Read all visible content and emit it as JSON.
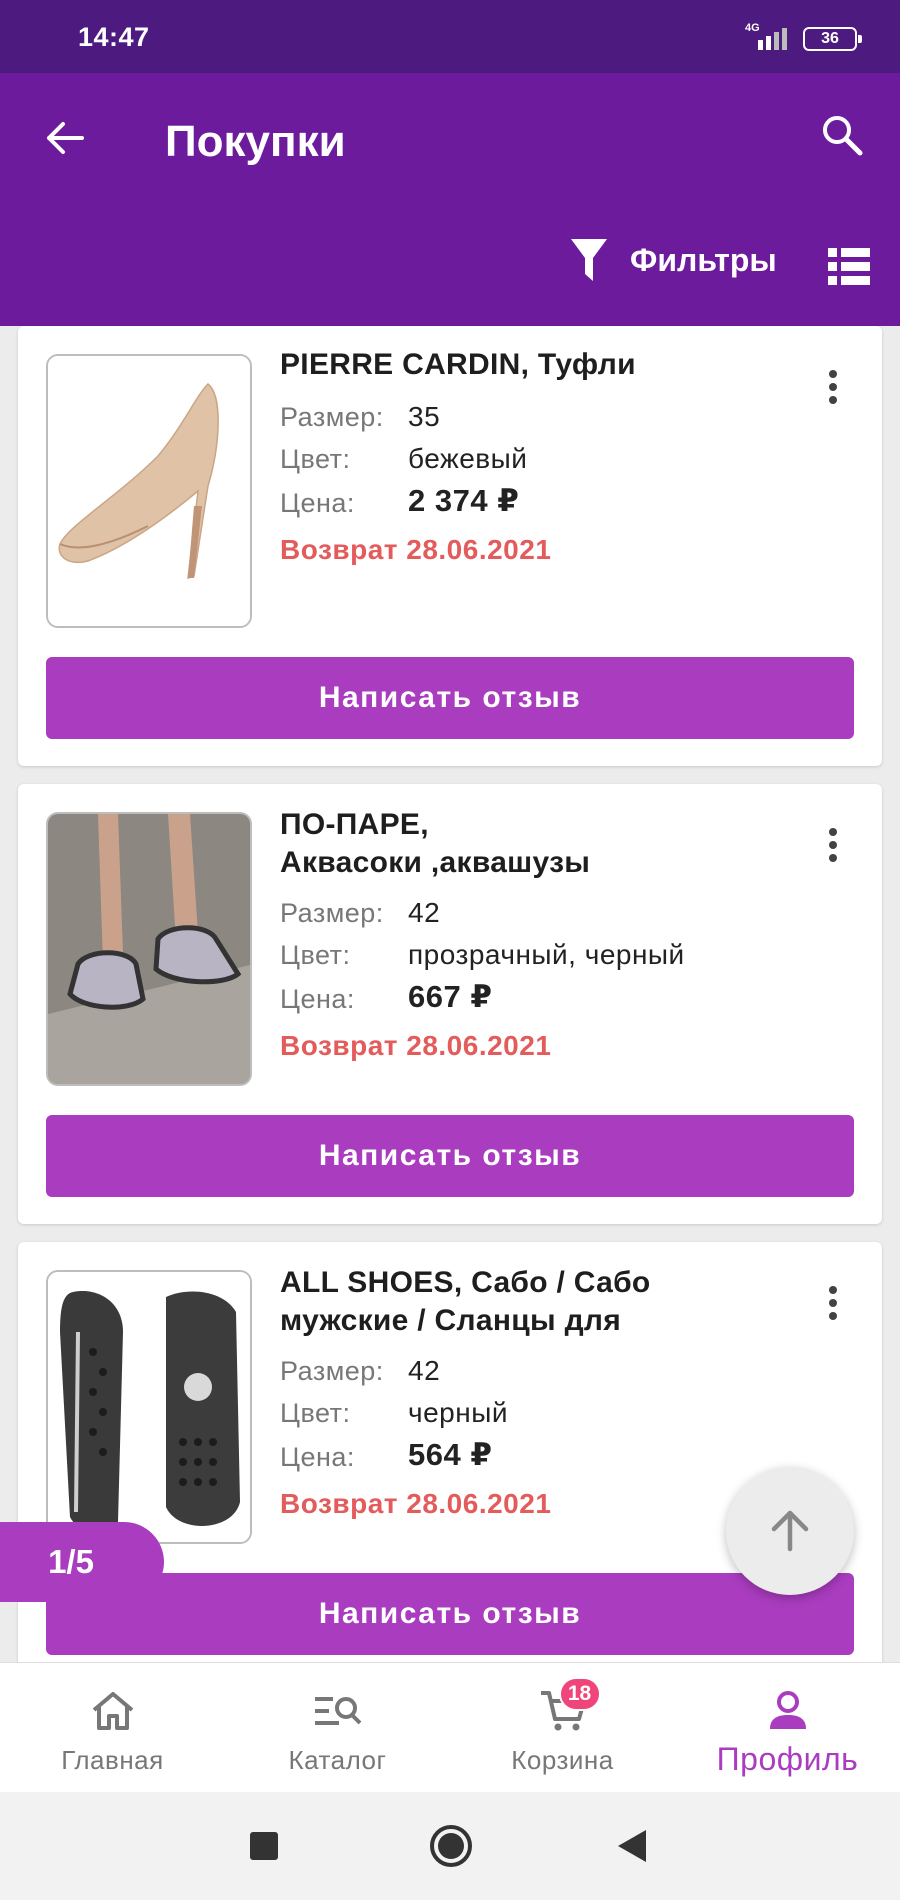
{
  "status_bar": {
    "time": "14:47",
    "network": "4G",
    "battery": "36"
  },
  "app_bar": {
    "title": "Покупки",
    "filters_label": "Фильтры"
  },
  "colors": {
    "header": "#6b1b9c",
    "status": "#4d1a80",
    "accent": "#a93cbf",
    "return_text": "#e35b5b",
    "badge": "#f0457a"
  },
  "labels": {
    "size": "Размер:",
    "color": "Цвет:",
    "price": "Цена:",
    "review_button": "Написать отзыв"
  },
  "items": [
    {
      "name_line1": "PIERRE CARDIN, Туфли",
      "name_line2": "",
      "size": "35",
      "color": "бежевый",
      "price": "2 374 ₽",
      "return": "Возврат 28.06.2021",
      "image": "beige-heel-image"
    },
    {
      "name_line1": "ПО-ПАРЕ,",
      "name_line2": "Аквасоки ,аквашузы",
      "size": "42",
      "color": "прозрачный, черный",
      "price": "667 ₽",
      "return": "Возврат 28.06.2021",
      "image": "aqua-shoes-image"
    },
    {
      "name_line1": "ALL SHOES, Сабо / Сабо",
      "name_line2": "мужские / Сланцы для",
      "size": "42",
      "color": "черный",
      "price": "564 ₽",
      "return": "Возврат 28.06.2021",
      "image": "black-clogs-image"
    }
  ],
  "page_indicator": "1/5",
  "bottom_nav": {
    "home": "Главная",
    "catalog": "Каталог",
    "cart": "Корзина",
    "cart_badge": "18",
    "profile": "Профиль"
  }
}
